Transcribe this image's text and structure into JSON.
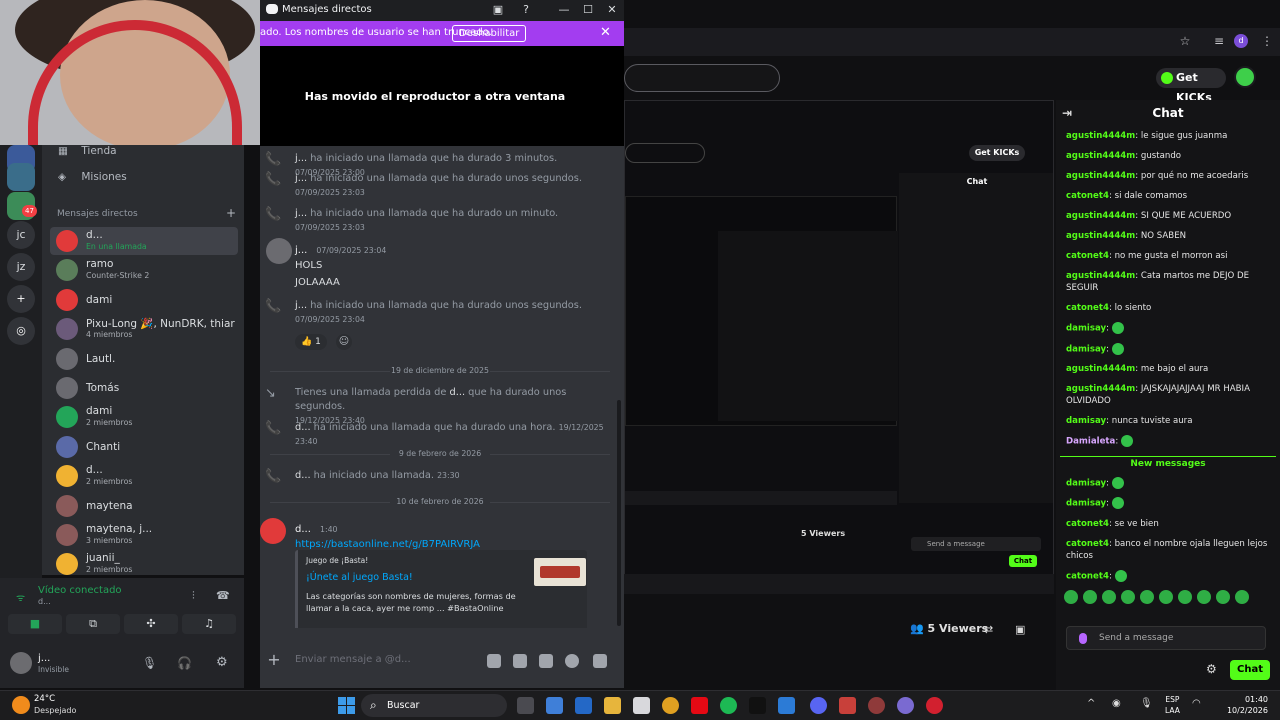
{
  "window": {
    "title": "Mensajes directos",
    "minimize": "—",
    "maximize": "☐",
    "close": "✕"
  },
  "banner": {
    "text": "ado. Los nombres de usuario se han truncado.",
    "button_label": "Deshabilitar",
    "close": "✕"
  },
  "player": {
    "message": "Has movido el reproductor a otra ventana"
  },
  "sidebar": {
    "store_label": "Tienda",
    "missions_label": "Misiones",
    "dm_header": "Mensajes directos",
    "dm_add": "+",
    "items": [
      {
        "name": "d...",
        "sub": "En una llamada",
        "sub_color": "#23a559"
      },
      {
        "name": "ramo",
        "sub": "Counter-Strike 2"
      },
      {
        "name": "dami",
        "sub": ""
      },
      {
        "name": "Pixu-Long 🎉, NunDRK, thiar",
        "sub": "4 miembros"
      },
      {
        "name": "Lautl.",
        "sub": ""
      },
      {
        "name": "Tomás",
        "sub": ""
      },
      {
        "name": "dami",
        "sub": "2 miembros"
      },
      {
        "name": "Chanti",
        "sub": ""
      },
      {
        "name": "d...",
        "sub": "2 miembros"
      },
      {
        "name": "maytena",
        "sub": ""
      },
      {
        "name": "maytena, j...",
        "sub": "3 miembros"
      },
      {
        "name": "juanii_",
        "sub": "2 miembros"
      }
    ],
    "server_labels": [
      "jc",
      "jz"
    ],
    "server_badge": "47"
  },
  "voice": {
    "status": "Vídeo conectado",
    "channel": "d..."
  },
  "user": {
    "name": "j...",
    "status": "Invisible"
  },
  "messages": {
    "calls_top": [
      {
        "who": "j...",
        "text": " ha iniciado una llamada que ha durado 3 minutos.",
        "time": "07/09/2025 23:00"
      },
      {
        "who": "j...",
        "text": " ha iniciado una llamada que ha durado unos segundos.",
        "time": "07/09/2025 23:03"
      },
      {
        "who": "j...",
        "text": " ha iniciado una llamada que ha durado un minuto.",
        "time": "07/09/2025 23:03"
      }
    ],
    "text_msg": {
      "author": "j...",
      "time": "07/09/2025 23:04",
      "lines": [
        "HOLS",
        "JOLAAAA"
      ]
    },
    "call_after": {
      "who": "j...",
      "text": " ha iniciado una llamada que ha durado unos segundos.",
      "time": "07/09/2025 23:04"
    },
    "reaction": {
      "emoji": "👍",
      "count": "1"
    },
    "dividers": [
      "19 de diciembre de 2025",
      "9 de febrero de 2026",
      "10 de febrero de 2026"
    ],
    "missed": {
      "pre": "Tienes una llamada perdida de ",
      "who": "d...",
      "post": " que ha durado unos segundos.",
      "time": "19/12/2025 23:40"
    },
    "call_dec": {
      "who": "d...",
      "text": " ha iniciado una llamada que ha durado una hora.",
      "time": "19/12/2025 23:40"
    },
    "call_feb": {
      "who": "d...",
      "text": " ha iniciado una llamada.",
      "time": "23:30"
    },
    "link_msg": {
      "author": "d...",
      "time": "1:40",
      "link": "https://bastaonline.net/g/B7PAIRVRJA"
    },
    "embed": {
      "provider": "Juego de ¡Basta!",
      "title": "¡Únete al juego Basta!",
      "description": "Las categorías son nombres de mujeres, formas de llamar a la caca, ayer me romp ... #BastaOnline"
    }
  },
  "composer": {
    "placeholder": "Enviar mensaje a @d..."
  },
  "stream": {
    "get_kicks": "Get KICKs",
    "chat_title": "Chat",
    "viewers": "5 Viewers",
    "send_placeholder": "Send a message",
    "chat_button": "Chat",
    "new_messages": "New messages",
    "chat_lines": [
      {
        "u": "agustin4444m",
        "t": "le sigue gus juanma"
      },
      {
        "u": "agustin4444m",
        "t": "gustando"
      },
      {
        "u": "agustin4444m",
        "t": "por qué no me acoedaris"
      },
      {
        "u": "catonet4",
        "t": "si dale comamos"
      },
      {
        "u": "agustin4444m",
        "t": "SI QUE ME ACUERDO"
      },
      {
        "u": "agustin4444m",
        "t": "NO SABEN"
      },
      {
        "u": "catonet4",
        "t": "no me gusta el morron asi"
      },
      {
        "u": "agustin4444m",
        "t": "Cata martos me DEJO DE SEGUIR"
      },
      {
        "u": "catonet4",
        "t": "lo siento"
      },
      {
        "u": "damisay",
        "t": ""
      },
      {
        "u": "damisay",
        "t": ""
      },
      {
        "u": "agustin4444m",
        "t": "me bajo el aura"
      },
      {
        "u": "agustin4444m",
        "t": "JAJSKAJAJAJJAAJ MR HABIA OLVIDADO"
      },
      {
        "u": "damisay",
        "t": "nunca tuviste aura"
      },
      {
        "u": "Damialeta",
        "t": ""
      }
    ],
    "chat_lines_after": [
      {
        "u": "damisay",
        "t": ""
      },
      {
        "u": "damisay",
        "t": ""
      },
      {
        "u": "catonet4",
        "t": "se ve bien"
      },
      {
        "u": "catonet4",
        "t": "banco el nombre ojala lleguen lejos chicos"
      },
      {
        "u": "catonet4",
        "t": ""
      }
    ]
  },
  "taskbar": {
    "temperature": "24°C",
    "condition": "Despejado",
    "search": "Buscar",
    "lang_top": "ESP",
    "lang_bottom": "LAA",
    "time": "01:40",
    "date": "10/2/2026"
  }
}
